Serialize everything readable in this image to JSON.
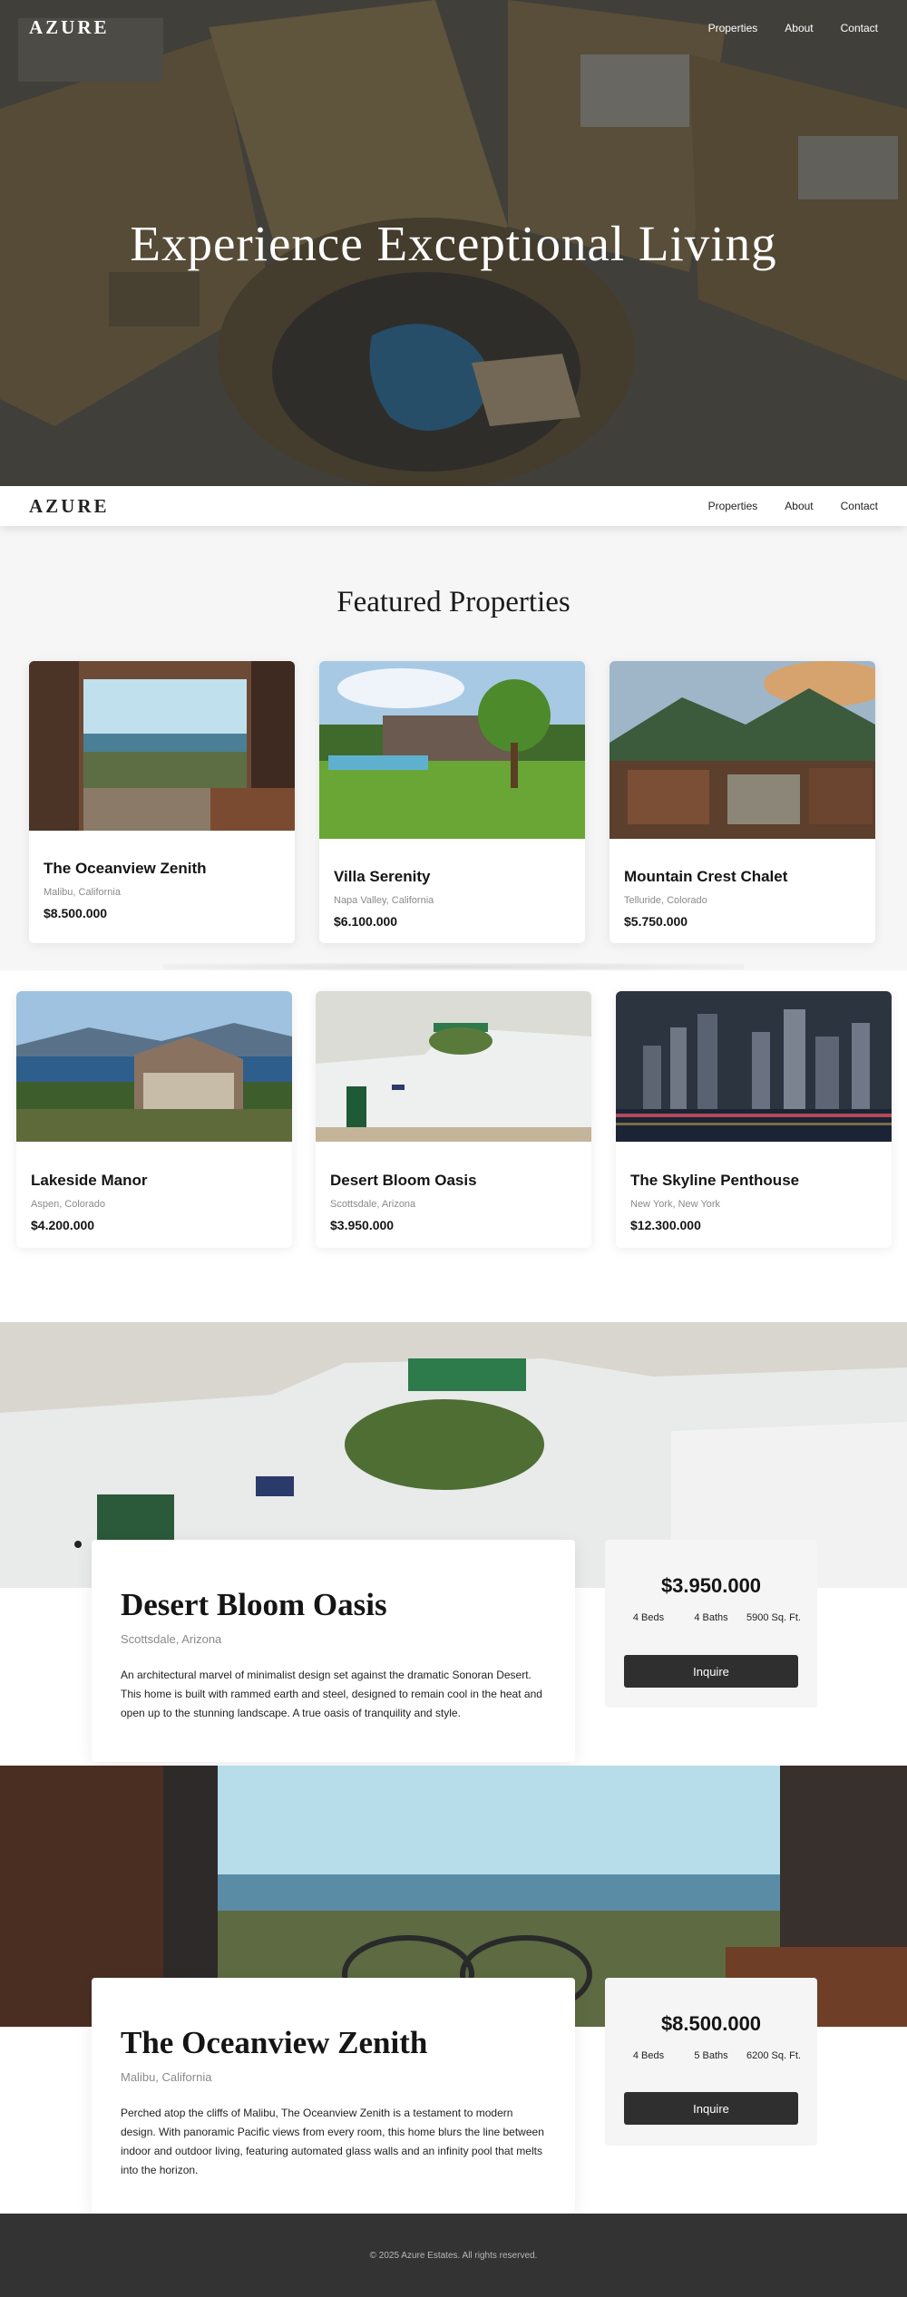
{
  "brand": "AZURE",
  "nav": {
    "links": [
      "Properties",
      "About",
      "Contact"
    ]
  },
  "hero": {
    "title": "Experience Exceptional Living"
  },
  "featured": {
    "title": "Featured Properties",
    "properties": [
      {
        "title": "The Oceanview Zenith",
        "location": "Malibu, California",
        "price": "$8.500.000"
      },
      {
        "title": "Villa Serenity",
        "location": "Napa Valley, California",
        "price": "$6.100.000"
      },
      {
        "title": "Mountain Crest Chalet",
        "location": "Telluride, Colorado",
        "price": "$5.750.000"
      },
      {
        "title": "Lakeside Manor",
        "location": "Aspen, Colorado",
        "price": "$4.200.000"
      },
      {
        "title": "Desert Bloom Oasis",
        "location": "Scottsdale, Arizona",
        "price": "$3.950.000"
      },
      {
        "title": "The Skyline Penthouse",
        "location": "New York, New York",
        "price": "$12.300.000"
      }
    ]
  },
  "details": [
    {
      "title": "Desert Bloom Oasis",
      "location": "Scottsdale, Arizona",
      "description": "An architectural marvel of minimalist design set against the dramatic Sonoran Desert. This home is built with rammed earth and steel, designed to remain cool in the heat and open up to the stunning landscape. A true oasis of tranquility and style.",
      "price": "$3.950.000",
      "beds": "4 Beds",
      "baths": "4 Baths",
      "area": "5900 Sq. Ft.",
      "button": "Inquire"
    },
    {
      "title": "The Oceanview Zenith",
      "location": "Malibu, California",
      "description": "Perched atop the cliffs of Malibu, The Oceanview Zenith is a testament to modern design. With panoramic Pacific views from every room, this home blurs the line between indoor and outdoor living, featuring automated glass walls and an infinity pool that melts into the horizon.",
      "price": "$8.500.000",
      "beds": "4 Beds",
      "baths": "5 Baths",
      "area": "6200 Sq. Ft.",
      "button": "Inquire"
    }
  ],
  "footer": {
    "text": "© 2025 Azure Estates. All rights reserved."
  },
  "colors": {
    "dark": "#2f2f2f",
    "section_bg": "#f6f6f6",
    "footer_bg": "#333333"
  }
}
